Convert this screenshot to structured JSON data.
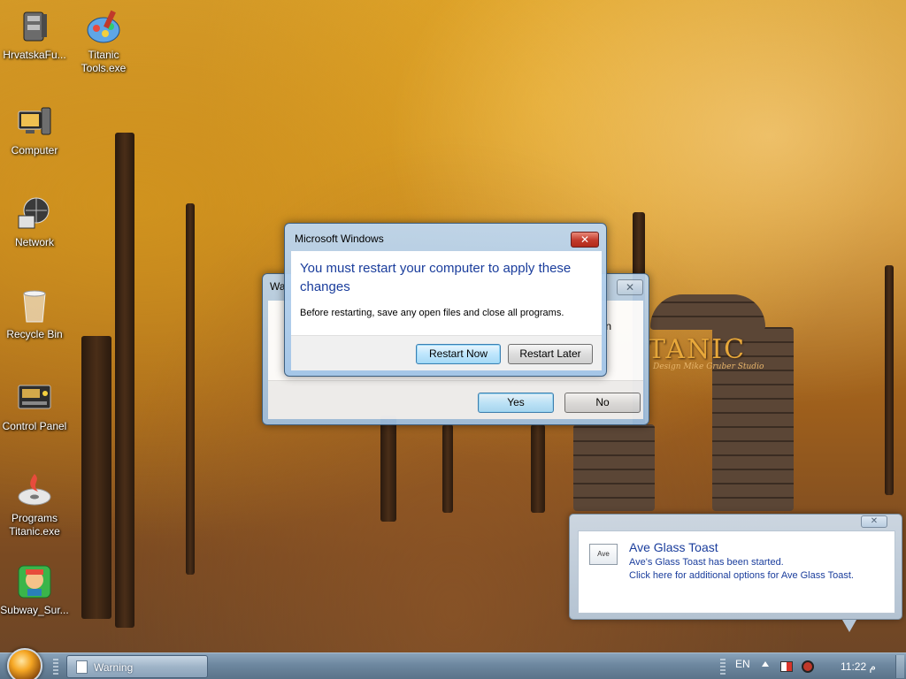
{
  "desktop": {
    "icons": [
      {
        "label": "HrvatskaFu..."
      },
      {
        "label": "Titanic Tools.exe"
      },
      {
        "label": "Computer"
      },
      {
        "label": "Network"
      },
      {
        "label": "Recycle Bin"
      },
      {
        "label": "Control Panel"
      },
      {
        "label": "Programs Titanic.exe"
      },
      {
        "label": "Subway_Sur..."
      }
    ],
    "wallpaper_text": "TANIC",
    "wallpaper_subtext": "Design Mike Gruber Studio"
  },
  "back_dialog": {
    "title": "Wa",
    "partial_text": "n",
    "yes_label": "Yes",
    "no_label": "No"
  },
  "restart_dialog": {
    "title": "Microsoft Windows",
    "heading": "You must restart your computer to apply these changes",
    "message": "Before restarting, save any open files and close all programs.",
    "restart_now_label": "Restart Now",
    "restart_later_label": "Restart Later"
  },
  "toast": {
    "icon_text": "Ave",
    "title": "Ave Glass Toast",
    "line1": "Ave's Glass Toast has been started.",
    "line2": "Click here for additional options for Ave Glass Toast."
  },
  "taskbar": {
    "window_button_label": "Warning",
    "language": "EN",
    "clock": "11:22  م"
  },
  "colors": {
    "accent_blue": "#1a3d9c",
    "close_red": "#c2392b"
  }
}
